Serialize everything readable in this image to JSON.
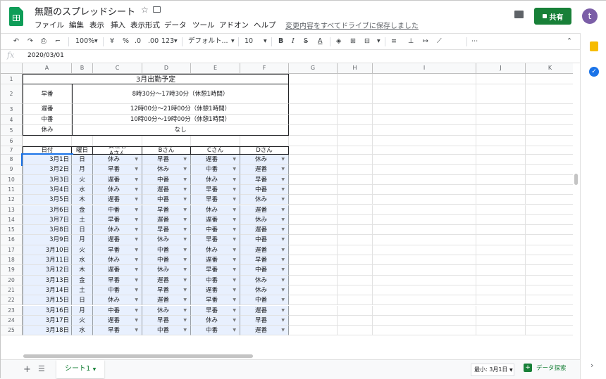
{
  "header": {
    "title": "無題のスプレッドシート",
    "menus": [
      "ファイル",
      "編集",
      "表示",
      "挿入",
      "表示形式",
      "データ",
      "ツール",
      "アドオン",
      "ヘルプ"
    ],
    "save_status": "変更内容をすべてドライブに保存しました",
    "share_label": "共有",
    "avatar_initial": "t"
  },
  "toolbar": {
    "zoom": "100%",
    "currency": "¥",
    "percent": "%",
    "dec_less": ".0",
    "dec_more": ".00",
    "number_format": "123",
    "font": "デフォルト...",
    "font_size": "10",
    "more": "⋯"
  },
  "formula_bar": {
    "fx": "fx",
    "value": "2020/03/01"
  },
  "grid": {
    "columns": [
      "A",
      "B",
      "C",
      "D",
      "E",
      "F",
      "G",
      "H",
      "I",
      "J",
      "K"
    ],
    "row_numbers": [
      "1",
      "2",
      "3",
      "4",
      "5",
      "6",
      "7",
      "8",
      "9",
      "10",
      "11",
      "12",
      "13",
      "14",
      "15",
      "16",
      "17",
      "18",
      "19",
      "20",
      "21",
      "22",
      "23",
      "24",
      "25"
    ],
    "title": "3月出勤予定",
    "shift_legend": [
      {
        "name": "早番",
        "time": "8時30分～17時30分（休憩1時間）"
      },
      {
        "name": "遅番",
        "time": "12時00分～21時00分（休憩1時間）"
      },
      {
        "name": "中番",
        "time": "10時00分～19時00分（休憩1時間）"
      },
      {
        "name": "休み",
        "time": "なし"
      }
    ],
    "table_headers": [
      "日付",
      "曜日",
      "責任者\nAさん",
      "Bさん",
      "Cさん",
      "Dさん"
    ],
    "rows": [
      [
        "3月1日",
        "日",
        "休み",
        "早番",
        "遅番",
        "休み"
      ],
      [
        "3月2日",
        "月",
        "早番",
        "休み",
        "中番",
        "遅番"
      ],
      [
        "3月3日",
        "火",
        "遅番",
        "中番",
        "休み",
        "早番"
      ],
      [
        "3月4日",
        "水",
        "休み",
        "遅番",
        "早番",
        "中番"
      ],
      [
        "3月5日",
        "木",
        "遅番",
        "中番",
        "早番",
        "休み"
      ],
      [
        "3月6日",
        "金",
        "中番",
        "早番",
        "休み",
        "遅番"
      ],
      [
        "3月7日",
        "土",
        "早番",
        "遅番",
        "遅番",
        "休み"
      ],
      [
        "3月8日",
        "日",
        "休み",
        "早番",
        "中番",
        "遅番"
      ],
      [
        "3月9日",
        "月",
        "遅番",
        "休み",
        "早番",
        "中番"
      ],
      [
        "3月10日",
        "火",
        "早番",
        "中番",
        "休み",
        "遅番"
      ],
      [
        "3月11日",
        "水",
        "休み",
        "中番",
        "遅番",
        "早番"
      ],
      [
        "3月12日",
        "木",
        "遅番",
        "休み",
        "早番",
        "中番"
      ],
      [
        "3月13日",
        "金",
        "早番",
        "遅番",
        "中番",
        "休み"
      ],
      [
        "3月14日",
        "土",
        "中番",
        "早番",
        "遅番",
        "休み"
      ],
      [
        "3月15日",
        "日",
        "休み",
        "遅番",
        "早番",
        "中番"
      ],
      [
        "3月16日",
        "月",
        "中番",
        "休み",
        "早番",
        "遅番"
      ],
      [
        "3月17日",
        "火",
        "遅番",
        "早番",
        "休み",
        "早番"
      ],
      [
        "3月18日",
        "水",
        "早番",
        "中番",
        "中番",
        "遅番"
      ]
    ]
  },
  "bottom": {
    "sheet_tab": "シート1",
    "summary": "最小: 3月1日",
    "explore": "データ探索"
  }
}
